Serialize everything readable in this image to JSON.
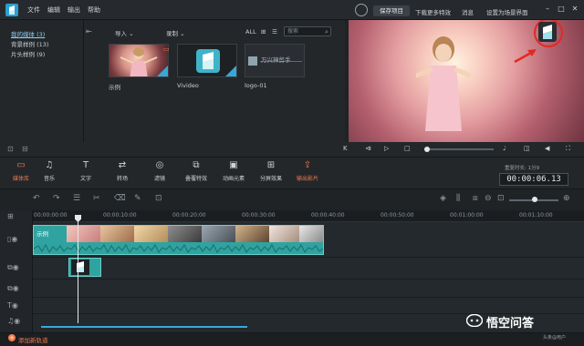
{
  "menu": {
    "items": [
      "文件",
      "编辑",
      "输出",
      "帮助"
    ]
  },
  "topbar": {
    "save_label": "保存项目",
    "links": [
      "下载更多特效",
      "消息",
      "设置为场景界面"
    ],
    "window": [
      "–",
      "□",
      "✕"
    ]
  },
  "library": {
    "categories": [
      "我的媒体 (3)",
      "背景样例 (13)",
      "片头样例 (9)"
    ],
    "import_label": "导入 ⌄",
    "record_label": "录制 ⌄",
    "all_label": "ALL",
    "search_placeholder": "搜索",
    "thumbs": [
      "示例",
      "Vivideo",
      "logo-01"
    ],
    "logo_thumb_text": "万兴神剪手"
  },
  "toolbar": {
    "tools": [
      "媒体库",
      "音乐",
      "文字",
      "转场",
      "滤镜",
      "叠覆特效",
      "动画元素",
      "分屏效果",
      "输出影片"
    ],
    "tool_icons": [
      "T"
    ],
    "duration_label": "重复时长: 1分9",
    "timecode": "00:00:06.13"
  },
  "ruler": [
    "00:00:00:00",
    "00:00:10:00",
    "00:00:20:00",
    "00:00:30:00",
    "00:00:40:00",
    "00:00:50:00",
    "00:01:00:00",
    "00:01:10:00"
  ],
  "timeline": {
    "clip_label": "示例",
    "add_track": "添加新轨道"
  },
  "brand": {
    "name": "悟空问答",
    "sub": "头条@用户"
  },
  "colors": {
    "accent": "#f07a4d",
    "clip": "#2fa3a0",
    "highlight": "#36a8d8",
    "watermark_ring": "#e02a22"
  }
}
